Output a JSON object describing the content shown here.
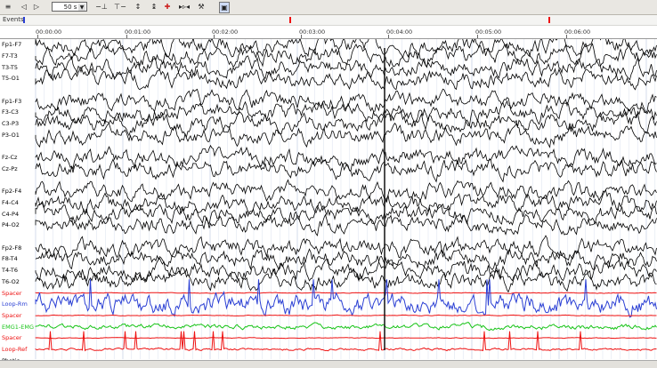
{
  "toolbar": {
    "zoom_value": "50 s"
  },
  "events_row": {
    "label": "Events",
    "markers": [
      {
        "t": 0.035,
        "color": "#2a3fd4"
      },
      {
        "t": 0.44,
        "color": "#e11"
      },
      {
        "t": 0.835,
        "color": "#e11"
      }
    ]
  },
  "time_axis": {
    "ticks": [
      "00:00:00",
      "00:01:00",
      "00:02:00",
      "00:03:00",
      "00:04:00",
      "00:05:00",
      "00:06:00"
    ]
  },
  "channels": [
    {
      "label": "Fp1-F7",
      "color": "#000000"
    },
    {
      "label": "F7-T3",
      "color": "#000000"
    },
    {
      "label": "T3-T5",
      "color": "#000000"
    },
    {
      "label": "T5-O1",
      "color": "#000000"
    },
    {
      "label": "",
      "color": "#000000"
    },
    {
      "label": "Fp1-F3",
      "color": "#000000"
    },
    {
      "label": "F3-C3",
      "color": "#000000"
    },
    {
      "label": "C3-P3",
      "color": "#000000"
    },
    {
      "label": "P3-O1",
      "color": "#000000"
    },
    {
      "label": "",
      "color": "#000000"
    },
    {
      "label": "Fz-Cz",
      "color": "#000000"
    },
    {
      "label": "Cz-Pz",
      "color": "#000000"
    },
    {
      "label": "",
      "color": "#000000"
    },
    {
      "label": "Fp2-F4",
      "color": "#000000"
    },
    {
      "label": "F4-C4",
      "color": "#000000"
    },
    {
      "label": "C4-P4",
      "color": "#000000"
    },
    {
      "label": "P4-O2",
      "color": "#000000"
    },
    {
      "label": "",
      "color": "#000000"
    },
    {
      "label": "Fp2-F8",
      "color": "#000000"
    },
    {
      "label": "F8-T4",
      "color": "#000000"
    },
    {
      "label": "T4-T6",
      "color": "#000000"
    },
    {
      "label": "T6-O2",
      "color": "#000000"
    },
    {
      "label": "Spacer",
      "color": "#e11"
    },
    {
      "label": "Loop-Rm",
      "color": "#2a3fd4"
    },
    {
      "label": "Spacer",
      "color": "#e11"
    },
    {
      "label": "EMG1-EMG",
      "color": "#18c418"
    },
    {
      "label": "Spacer",
      "color": "#e11"
    },
    {
      "label": "Loop-Ref",
      "color": "#e11"
    },
    {
      "label": "Photic",
      "color": "#000000"
    }
  ],
  "colors": {
    "eeg": "#000000",
    "blue": "#2a3fd4",
    "green": "#18c418",
    "red": "#e11",
    "grid": "#c9d3e6"
  }
}
